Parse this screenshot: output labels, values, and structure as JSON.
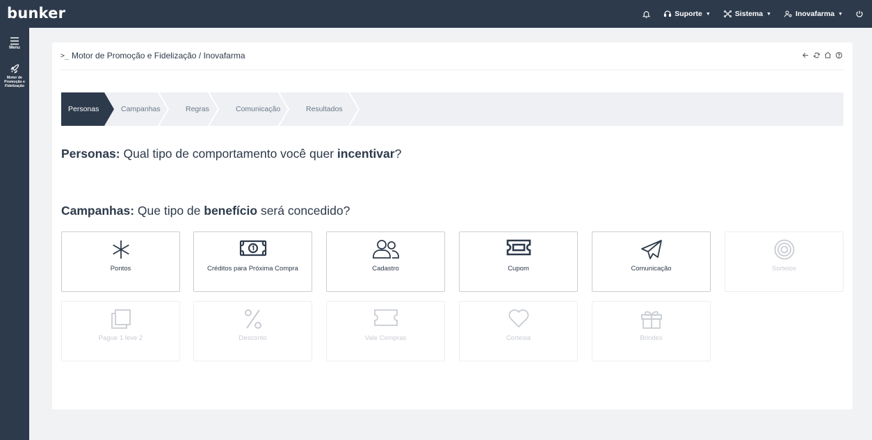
{
  "app": {
    "logo": "bunker"
  },
  "topbar": {
    "suporte": "Suporte",
    "sistema": "Sistema",
    "user": "Inovafarma",
    "icons": [
      "bell-icon",
      "headset-icon",
      "network-icon",
      "user-gear-icon",
      "power-icon"
    ]
  },
  "sidebar": {
    "menu_label": "Menu",
    "module_label": "Motor de Promoção e Fidelização"
  },
  "breadcrumb": {
    "prompt": ">_",
    "text": "Motor de Promoção e Fidelização / Inovafarma"
  },
  "stepper": {
    "steps": [
      {
        "label": "Personas",
        "active": true
      },
      {
        "label": "Campanhas",
        "active": false
      },
      {
        "label": "Regras",
        "active": false
      },
      {
        "label": "Comunicação",
        "active": false
      },
      {
        "label": "Resultados",
        "active": false
      }
    ]
  },
  "personas_heading": {
    "strong": "Personas:",
    "part1": " Qual tipo de comportamento você quer ",
    "emph": "incentivar",
    "part2": "?"
  },
  "campanhas_heading": {
    "strong": "Campanhas:",
    "part1": " Que tipo de ",
    "emph": "benefício",
    "part2": " será concedido?"
  },
  "benefits": [
    {
      "label": "Pontos",
      "icon": "asterisk-icon",
      "enabled": true
    },
    {
      "label": "Créditos para Próxima Compra",
      "icon": "money-icon",
      "enabled": true
    },
    {
      "label": "Cadastro",
      "icon": "users-icon",
      "enabled": true
    },
    {
      "label": "Cupom",
      "icon": "ticket-icon",
      "enabled": true
    },
    {
      "label": "Comunicação",
      "icon": "paper-plane-icon",
      "enabled": true
    },
    {
      "label": "Sorteios",
      "icon": "target-icon",
      "enabled": false
    },
    {
      "label": "Pague 1 leve 2",
      "icon": "copy-icon",
      "enabled": false
    },
    {
      "label": "Desconto",
      "icon": "percent-icon",
      "enabled": false
    },
    {
      "label": "Vale Compras",
      "icon": "voucher-icon",
      "enabled": false
    },
    {
      "label": "Cortesia",
      "icon": "heart-icon",
      "enabled": false
    },
    {
      "label": "Brindes",
      "icon": "gift-icon",
      "enabled": false
    }
  ],
  "colors": {
    "navy": "#2d3a4b",
    "stepper_bg": "#eef0f4",
    "tile_border": "#c9cdd3",
    "disabled_text": "#c8ccd2"
  }
}
